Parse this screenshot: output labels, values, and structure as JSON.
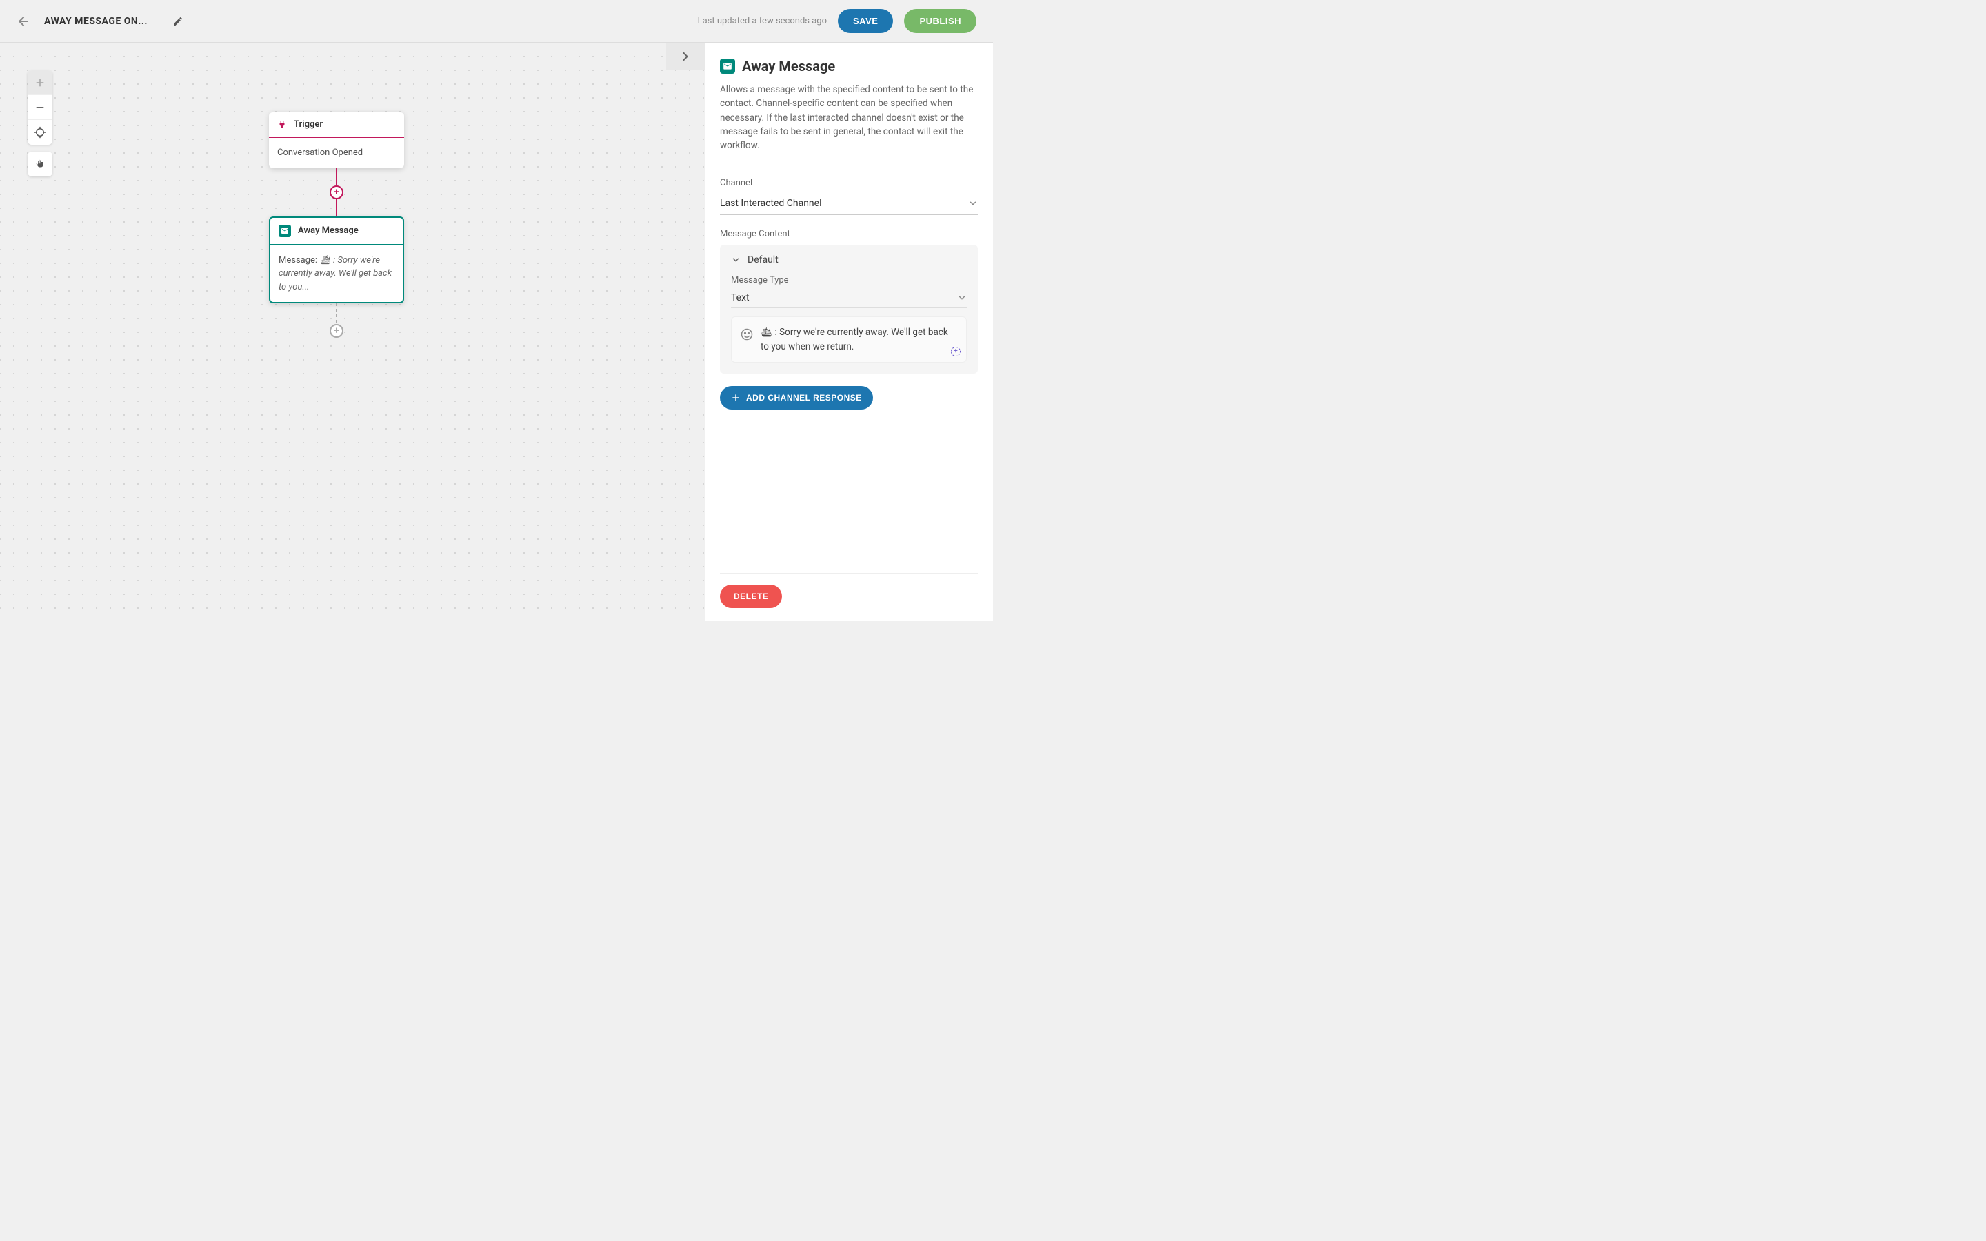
{
  "header": {
    "title": "AWAY MESSAGE ON...",
    "last_updated": "Last updated a few seconds ago",
    "save_label": "SAVE",
    "publish_label": "PUBLISH"
  },
  "nodes": {
    "trigger": {
      "title": "Trigger",
      "body": "Conversation Opened"
    },
    "away": {
      "title": "Away Message",
      "body_prefix": "Message: ",
      "body_emoji": "🛳",
      "body_text": " : Sorry we're currently away. We'll get back to you..."
    }
  },
  "sidebar": {
    "title": "Away Message",
    "description": "Allows a message with the specified content to be sent to the contact. Channel-specific content can be specified when necessary. If the last interacted channel doesn't exist or the message fails to be sent in general, the contact will exit the workflow.",
    "channel_label": "Channel",
    "channel_value": "Last Interacted Channel",
    "message_content_label": "Message Content",
    "default_label": "Default",
    "message_type_label": "Message Type",
    "message_type_value": "Text",
    "message_emoji": "🛳",
    "message_text": " : Sorry we're currently away. We'll get back to you when we return.",
    "add_channel_label": "ADD CHANNEL RESPONSE",
    "delete_label": "DELETE"
  }
}
